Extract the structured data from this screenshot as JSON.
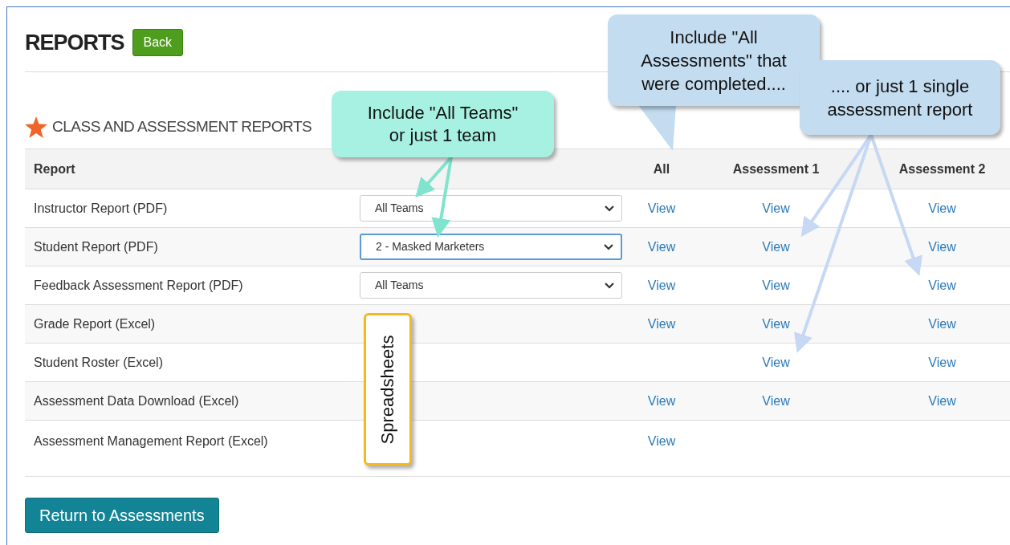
{
  "title": "REPORTS",
  "back_button": "Back",
  "section_title": "CLASS AND ASSESSMENT REPORTS",
  "table": {
    "columns": [
      "Report",
      "All",
      "Assessment 1",
      "Assessment 2"
    ],
    "rows": [
      {
        "report": "Instructor Report (PDF)",
        "team_select": {
          "value": "All Teams",
          "focused": false
        },
        "all": "View",
        "assessment_1": "View",
        "assessment_2": "View"
      },
      {
        "report": "Student Report (PDF)",
        "team_select": {
          "value": "2 - Masked Marketers",
          "focused": true
        },
        "all": "View",
        "assessment_1": "View",
        "assessment_2": "View"
      },
      {
        "report": "Feedback Assessment Report (PDF)",
        "team_select": {
          "value": "All Teams",
          "focused": false
        },
        "all": "View",
        "assessment_1": "View",
        "assessment_2": "View"
      },
      {
        "report": "Grade Report (Excel)",
        "all": "View",
        "assessment_1": "View",
        "assessment_2": "View"
      },
      {
        "report": "Student Roster (Excel)",
        "assessment_1": "View",
        "assessment_2": "View"
      },
      {
        "report": "Assessment Data Download (Excel)",
        "all": "View",
        "assessment_1": "View",
        "assessment_2": "View"
      },
      {
        "report": "Assessment Management Report (Excel)",
        "all": "View"
      }
    ]
  },
  "return_button": "Return to Assessments",
  "annotations": [
    {
      "kind": "teams",
      "text": "Include \"All Teams\" or just 1 team"
    },
    {
      "kind": "all",
      "text": "Include \"All Assessments\" that were completed...."
    },
    {
      "kind": "single",
      "text": ".... or just 1 single assessment report"
    },
    {
      "kind": "spreadsheets",
      "text": "Spreadsheets"
    }
  ]
}
